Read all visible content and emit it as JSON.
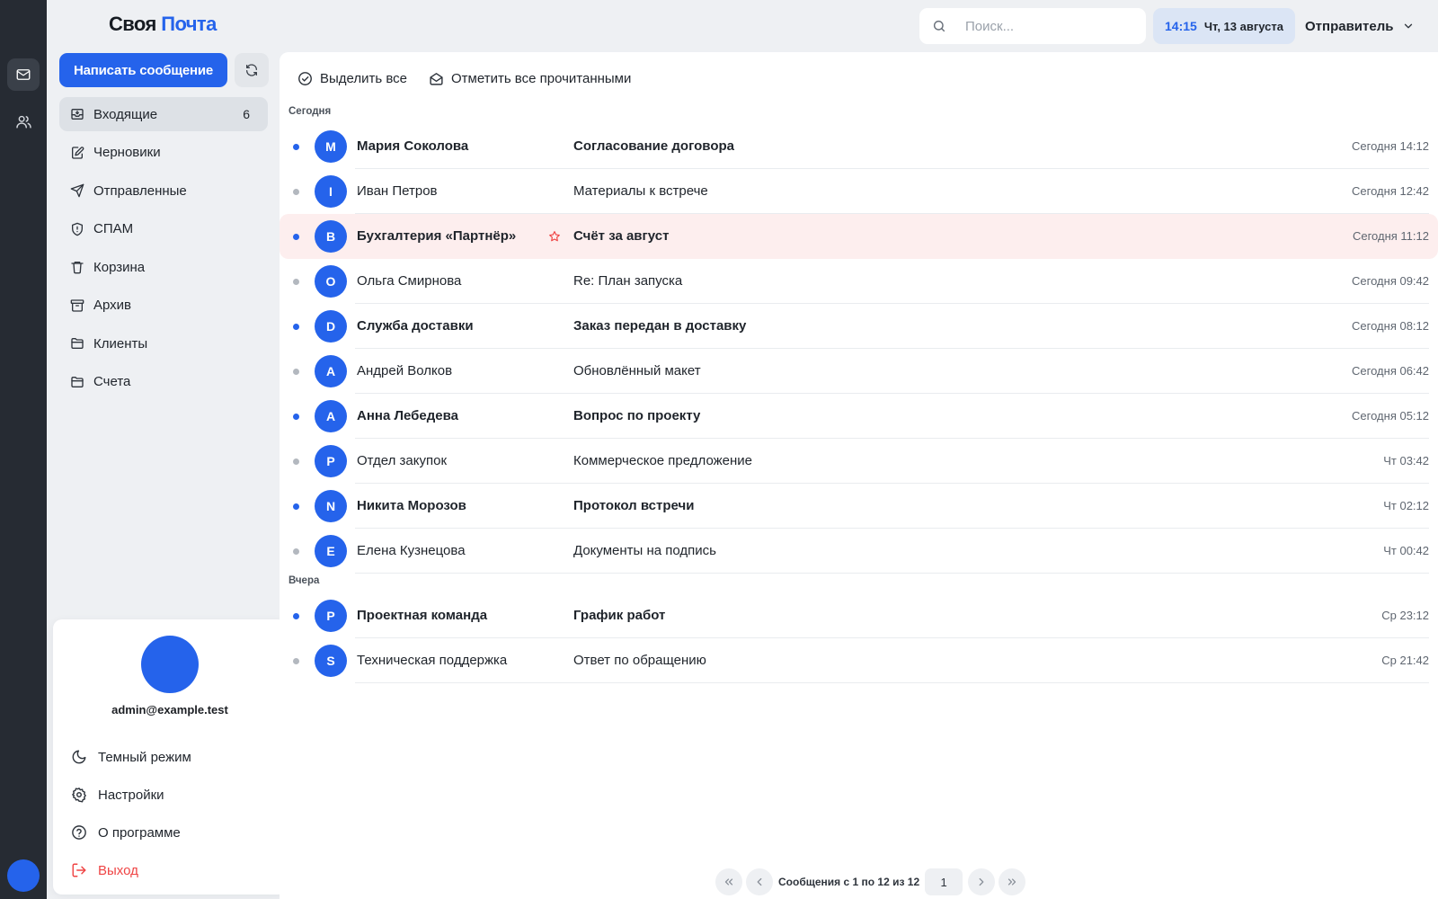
{
  "app": {
    "logo_part1": "Своя",
    "logo_part2": "Почта",
    "accent_color": "#2563eb"
  },
  "rail": {
    "items": [
      {
        "icon": "mail-icon",
        "active": true
      },
      {
        "icon": "contacts-icon",
        "active": false
      }
    ]
  },
  "sidebar": {
    "compose_label": "Написать сообщение",
    "refresh_icon": "refresh-icon",
    "folders": [
      {
        "label": "Входящие",
        "count": "6",
        "icon": "inbox-icon",
        "active": true
      },
      {
        "label": "Черновики",
        "count": "",
        "icon": "draft-icon"
      },
      {
        "label": "Отправленные",
        "count": "",
        "icon": "send-icon"
      },
      {
        "label": "СПАМ",
        "count": "",
        "icon": "shield-icon"
      },
      {
        "label": "Корзина",
        "count": "",
        "icon": "trash-icon"
      },
      {
        "label": "Архив",
        "count": "",
        "icon": "archive-icon"
      },
      {
        "label": "Клиенты",
        "count": "",
        "icon": "folder-icon"
      },
      {
        "label": "Счета",
        "count": "",
        "icon": "folder-icon"
      }
    ]
  },
  "user_menu": {
    "email": "admin@example.test",
    "items": [
      {
        "label": "Темный режим",
        "icon": "moon-icon"
      },
      {
        "label": "Настройки",
        "icon": "gear-icon"
      },
      {
        "label": "О программе",
        "icon": "help-icon"
      },
      {
        "label": "Выход",
        "icon": "logout-icon",
        "danger": true
      }
    ]
  },
  "topbar": {
    "search_placeholder": "Поиск...",
    "time": "14:15",
    "date": "Чт, 13 августа",
    "sender_label": "Отправитель"
  },
  "toolbar": {
    "select_all": "Выделить все",
    "mark_all_read": "Отметить все прочитанными"
  },
  "mail_groups": [
    {
      "label": "Сегодня",
      "messages": [
        {
          "initial": "M",
          "sender": "Мария Соколова",
          "subject": "Согласование договора",
          "time": "Сегодня 14:12",
          "unread": true,
          "flagged": false
        },
        {
          "initial": "I",
          "sender": "Иван Петров",
          "subject": "Материалы к встрече",
          "time": "Сегодня 12:42",
          "unread": false,
          "flagged": false
        },
        {
          "initial": "B",
          "sender": "Бухгалтерия «Партнёр»",
          "subject": "Счёт за август",
          "time": "Сегодня 11:12",
          "unread": true,
          "flagged": true
        },
        {
          "initial": "O",
          "sender": "Ольга Смирнова",
          "subject": "Re: План запуска",
          "time": "Сегодня 09:42",
          "unread": false,
          "flagged": false
        },
        {
          "initial": "D",
          "sender": "Служба доставки",
          "subject": "Заказ передан в доставку",
          "time": "Сегодня 08:12",
          "unread": true,
          "flagged": false
        },
        {
          "initial": "A",
          "sender": "Андрей Волков",
          "subject": "Обновлённый макет",
          "time": "Сегодня 06:42",
          "unread": false,
          "flagged": false
        },
        {
          "initial": "A",
          "sender": "Анна Лебедева",
          "subject": "Вопрос по проекту",
          "time": "Сегодня 05:12",
          "unread": true,
          "flagged": false
        },
        {
          "initial": "P",
          "sender": "Отдел закупок",
          "subject": "Коммерческое предложение",
          "time": "Чт 03:42",
          "unread": false,
          "flagged": false
        },
        {
          "initial": "N",
          "sender": "Никита Морозов",
          "subject": "Протокол встречи",
          "time": "Чт 02:12",
          "unread": true,
          "flagged": false
        },
        {
          "initial": "E",
          "sender": "Елена Кузнецова",
          "subject": "Документы на подпись",
          "time": "Чт 00:42",
          "unread": false,
          "flagged": false
        }
      ]
    },
    {
      "label": "Вчера",
      "messages": [
        {
          "initial": "P",
          "sender": "Проектная команда",
          "subject": "График работ",
          "time": "Ср 23:12",
          "unread": true,
          "flagged": false
        },
        {
          "initial": "S",
          "sender": "Техническая поддержка",
          "subject": "Ответ по обращению",
          "time": "Ср 21:42",
          "unread": false,
          "flagged": false
        }
      ]
    }
  ],
  "pagination": {
    "info": "Сообщения с 1 по 12 из 12",
    "current_page": "1"
  }
}
